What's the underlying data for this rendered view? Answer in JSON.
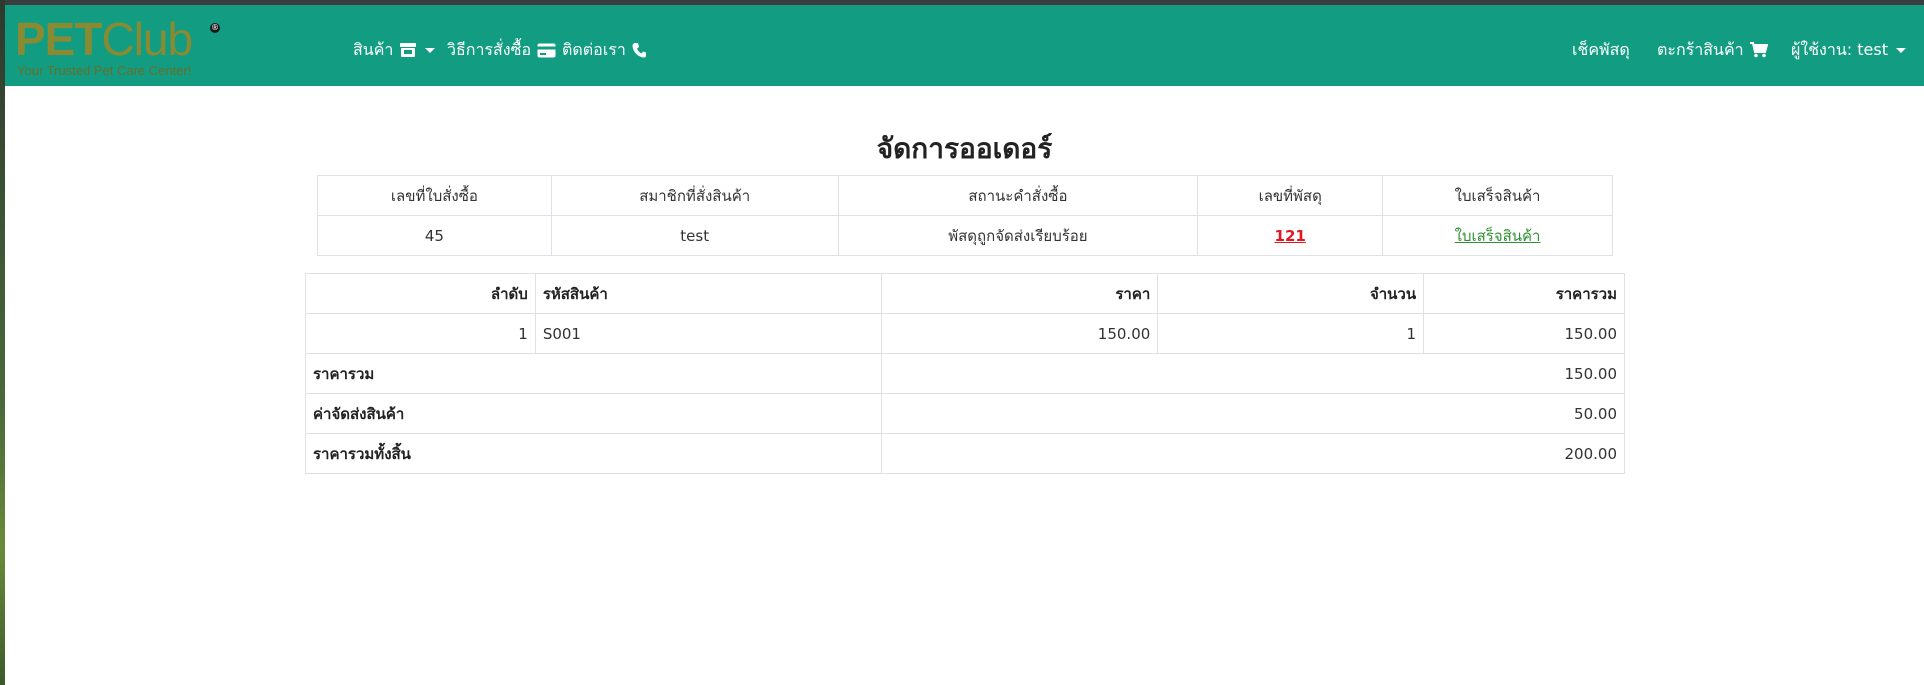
{
  "navbar": {
    "logo": {
      "pet": "PET",
      "club": "Club",
      "tagline": "Your Trusted Pet Care Center!"
    },
    "products": {
      "label": "สินค้า",
      "icon": "store-icon"
    },
    "how_to_order": {
      "label": "วิธีการสั่งซื้อ",
      "icon": "credit-card-icon"
    },
    "contact": {
      "label": "ติดต่อเรา",
      "icon": "phone-icon"
    },
    "track_parcel": {
      "label": "เช็คพัสดุ"
    },
    "cart": {
      "label": "ตะกร้าสินค้า",
      "icon": "cart-icon"
    },
    "user": {
      "label": "ผู้ใช้งาน: test"
    },
    "colors": {
      "background": "#129d82",
      "text": "#ffffff",
      "logo": "#8a8a33"
    }
  },
  "page_title": "จัดการออเดอร์",
  "order": {
    "headers": [
      "เลขที่ใบสั่งซื้อ",
      "สมาชิกที่สั่งสินค้า",
      "สถานะคำสั่งซื้อ",
      "เลขที่พัสดุ",
      "ใบเสร็จสินค้า"
    ],
    "order_no": "45",
    "member": "test",
    "status": "พัสดุถูกจัดส่งเรียบร้อย",
    "tracking_no": "121",
    "receipt_link": "ใบเสร็จสินค้า",
    "colors": {
      "tracking_link": "#e3171f",
      "receipt_link": "#2f9232"
    }
  },
  "items": {
    "headers": [
      "ลำดับ",
      "รหัสสินค้า",
      "ราคา",
      "จำนวน",
      "ราคารวม"
    ],
    "rows": [
      {
        "index": "1",
        "code": "S001",
        "price": "150.00",
        "qty": "1",
        "total": "150.00"
      }
    ],
    "summary": {
      "subtotal_label": "ราคารวม",
      "subtotal": "150.00",
      "shipping_label": "ค่าจัดส่งสินค้า",
      "shipping": "50.00",
      "grand_total_label": "ราคารวมทั้งสิ้น",
      "grand_total": "200.00"
    }
  }
}
